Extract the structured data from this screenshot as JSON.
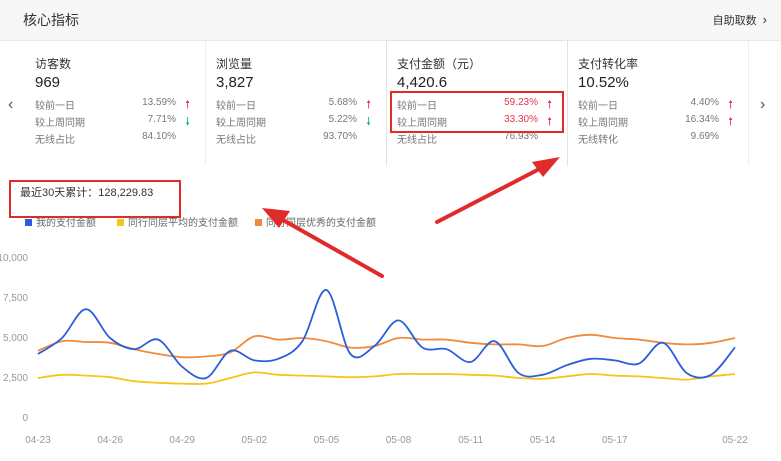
{
  "header": {
    "title": "核心指标",
    "action_label": "自助取数",
    "action_icon": "chevron-right-icon"
  },
  "nav": {
    "prev_icon": "chevron-left-icon",
    "next_icon": "chevron-right-icon"
  },
  "cards": [
    {
      "title": "访客数",
      "value": "969",
      "rows": [
        {
          "label": "较前一日",
          "value": "13.59%",
          "trend": "up"
        },
        {
          "label": "较上周同期",
          "value": "7.71%",
          "trend": "down"
        },
        {
          "label": "无线占比",
          "value": "84.10%",
          "trend": ""
        }
      ]
    },
    {
      "title": "浏览量",
      "value": "3,827",
      "rows": [
        {
          "label": "较前一日",
          "value": "5.68%",
          "trend": "up"
        },
        {
          "label": "较上周同期",
          "value": "5.22%",
          "trend": "down"
        },
        {
          "label": "无线占比",
          "value": "93.70%",
          "trend": ""
        }
      ]
    },
    {
      "title": "支付金额（元）",
      "value": "4,420.6",
      "rows": [
        {
          "label": "较前一日",
          "value": "59.23%",
          "trend": "up"
        },
        {
          "label": "较上周同期",
          "value": "33.30%",
          "trend": "up"
        },
        {
          "label": "无线占比",
          "value": "76.93%",
          "trend": ""
        }
      ]
    },
    {
      "title": "支付转化率",
      "value": "10.52%",
      "rows": [
        {
          "label": "较前一日",
          "value": "4.40%",
          "trend": "up"
        },
        {
          "label": "较上周同期",
          "value": "16.34%",
          "trend": "up"
        },
        {
          "label": "无线转化",
          "value": "9.69%",
          "trend": ""
        }
      ]
    }
  ],
  "cumulative": {
    "label": "最近30天累计：128,229.83"
  },
  "colors": {
    "up": "#e8334a",
    "down": "#16b38a",
    "mine": "#2b5fd9",
    "avg": "#f5c518",
    "best": "#f08a3c",
    "annotation": "#e12a2a"
  },
  "chart_data": {
    "type": "line",
    "x": [
      "04-23",
      "04-24",
      "04-25",
      "04-26",
      "04-27",
      "04-28",
      "04-29",
      "04-30",
      "05-01",
      "05-02",
      "05-03",
      "05-04",
      "05-05",
      "05-06",
      "05-07",
      "05-08",
      "05-09",
      "05-10",
      "05-11",
      "05-12",
      "05-13",
      "05-14",
      "05-15",
      "05-16",
      "05-17",
      "05-18",
      "05-19",
      "05-20",
      "05-21",
      "05-22"
    ],
    "tick_labels": [
      "04-23",
      "04-26",
      "04-29",
      "05-02",
      "05-05",
      "05-08",
      "05-11",
      "05-14",
      "05-17",
      "05-22"
    ],
    "y_ticks": [
      "0",
      "2,500",
      "5,000",
      "7,500",
      "10,000"
    ],
    "ylim": [
      0,
      10000
    ],
    "series": [
      {
        "name": "我的支付金额",
        "color": "#2b5fd9",
        "values": [
          4000,
          5000,
          6800,
          5000,
          4300,
          4900,
          3200,
          2500,
          4200,
          3600,
          3700,
          4800,
          8000,
          4000,
          4500,
          6100,
          4400,
          4300,
          3500,
          4800,
          2800,
          2700,
          3300,
          3700,
          3600,
          3400,
          4700,
          2800,
          2700,
          4420
        ]
      },
      {
        "name": "同行同层平均的支付金额",
        "color": "#f5c518",
        "values": [
          2500,
          2700,
          2650,
          2550,
          2300,
          2200,
          2150,
          2150,
          2500,
          2850,
          2700,
          2650,
          2600,
          2550,
          2600,
          2750,
          2750,
          2750,
          2700,
          2650,
          2500,
          2450,
          2600,
          2750,
          2650,
          2600,
          2500,
          2400,
          2600,
          2750
        ]
      },
      {
        "name": "同行同层优秀的支付金额",
        "color": "#f08a3c",
        "values": [
          4200,
          4800,
          4750,
          4700,
          4300,
          4000,
          3800,
          3850,
          4100,
          5100,
          4900,
          5000,
          4800,
          4400,
          4500,
          5000,
          4900,
          4900,
          4700,
          4600,
          4600,
          4500,
          5000,
          5200,
          5000,
          4900,
          4700,
          4600,
          4700,
          5000
        ]
      }
    ]
  }
}
